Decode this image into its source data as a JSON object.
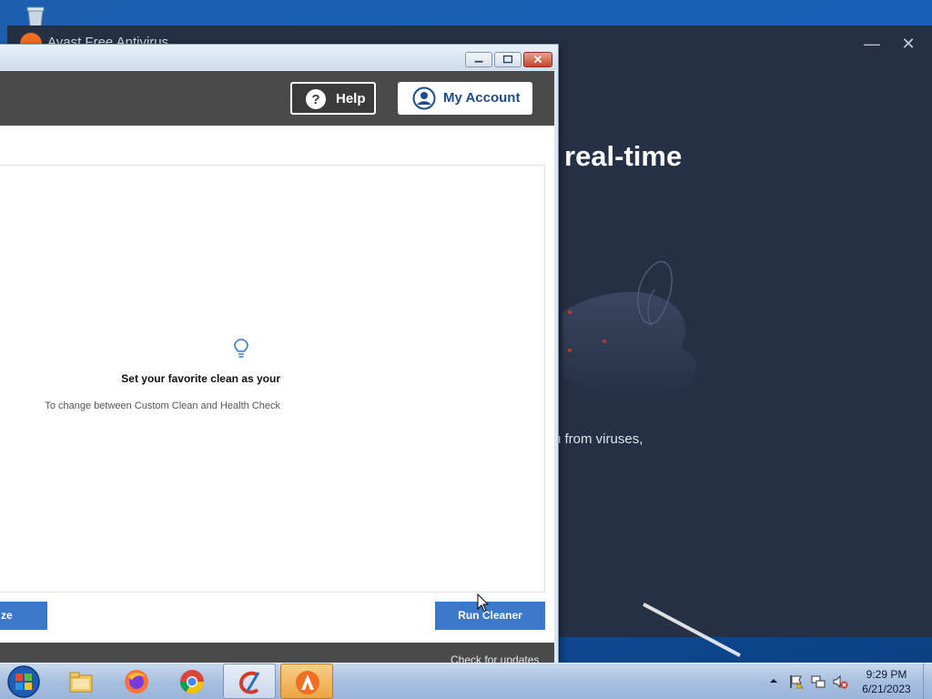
{
  "avast": {
    "title": "Avast Free Antivirus",
    "headline": "real-time",
    "body_text": "u from viruses,"
  },
  "ccleaner": {
    "header": {
      "help_label": "Help",
      "account_label": "My Account"
    },
    "tip": {
      "title": "Set your favorite clean as your",
      "text": "To change between Custom Clean and Health Check"
    },
    "buttons": {
      "analyze_label": "ze",
      "run_label": "Run Cleaner"
    },
    "footer": {
      "update_link": "Check for updates"
    }
  },
  "taskbar": {
    "apps": [
      "explorer-icon",
      "firefox-icon",
      "chrome-icon",
      "ccleaner-icon",
      "avast-icon"
    ],
    "clock": {
      "time": "9:29 PM",
      "date": "6/21/2023"
    }
  },
  "colors": {
    "ccleaner_header": "#4a4a4a",
    "ccleaner_button": "#3a78c9",
    "avast_background": "#253045",
    "avast_accent": "#f26f21"
  }
}
